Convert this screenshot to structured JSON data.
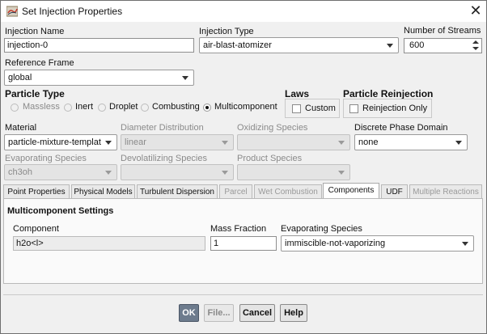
{
  "window": {
    "title": "Set Injection Properties"
  },
  "injection_name": {
    "label": "Injection Name",
    "value": "injection-0"
  },
  "injection_type": {
    "label": "Injection Type",
    "value": "air-blast-atomizer"
  },
  "number_of_streams": {
    "label": "Number of Streams",
    "value": "600"
  },
  "reference_frame": {
    "label": "Reference Frame",
    "value": "global"
  },
  "particle_type": {
    "label": "Particle Type",
    "options": [
      "Massless",
      "Inert",
      "Droplet",
      "Combusting",
      "Multicomponent"
    ],
    "selected": "Multicomponent"
  },
  "laws": {
    "label": "Laws",
    "custom_label": "Custom",
    "custom_checked": false
  },
  "particle_reinjection": {
    "label": "Particle Reinjection",
    "reinjection_only_label": "Reinjection Only",
    "checked": false
  },
  "material": {
    "label": "Material",
    "value": "particle-mixture-templat"
  },
  "diameter_distribution": {
    "label": "Diameter Distribution",
    "value": "linear"
  },
  "oxidizing_species": {
    "label": "Oxidizing Species",
    "value": ""
  },
  "discrete_phase_domain": {
    "label": "Discrete Phase Domain",
    "value": "none"
  },
  "evaporating_species": {
    "label": "Evaporating Species",
    "value": "ch3oh"
  },
  "devolatilizing_species": {
    "label": "Devolatilizing Species",
    "value": ""
  },
  "product_species": {
    "label": "Product Species",
    "value": ""
  },
  "tabs": [
    {
      "label": "Point Properties",
      "enabled": true
    },
    {
      "label": "Physical Models",
      "enabled": true
    },
    {
      "label": "Turbulent Dispersion",
      "enabled": true
    },
    {
      "label": "Parcel",
      "enabled": false
    },
    {
      "label": "Wet Combustion",
      "enabled": false
    },
    {
      "label": "Components",
      "enabled": true,
      "active": true
    },
    {
      "label": "UDF",
      "enabled": true
    },
    {
      "label": "Multiple Reactions",
      "enabled": false
    }
  ],
  "multicomponent": {
    "title": "Multicomponent Settings",
    "col_component": "Component",
    "col_mass_fraction": "Mass Fraction",
    "col_evaporating_species": "Evaporating Species",
    "row": {
      "component": "h2o<l>",
      "mass_fraction": "1",
      "evaporating_species": "immiscible-not-vaporizing"
    }
  },
  "buttons": {
    "ok": "OK",
    "file": "File...",
    "cancel": "Cancel",
    "help": "Help"
  },
  "colors": {
    "primary_button": "#6d7b8d",
    "dialog_bg": "#f0f0f0"
  }
}
